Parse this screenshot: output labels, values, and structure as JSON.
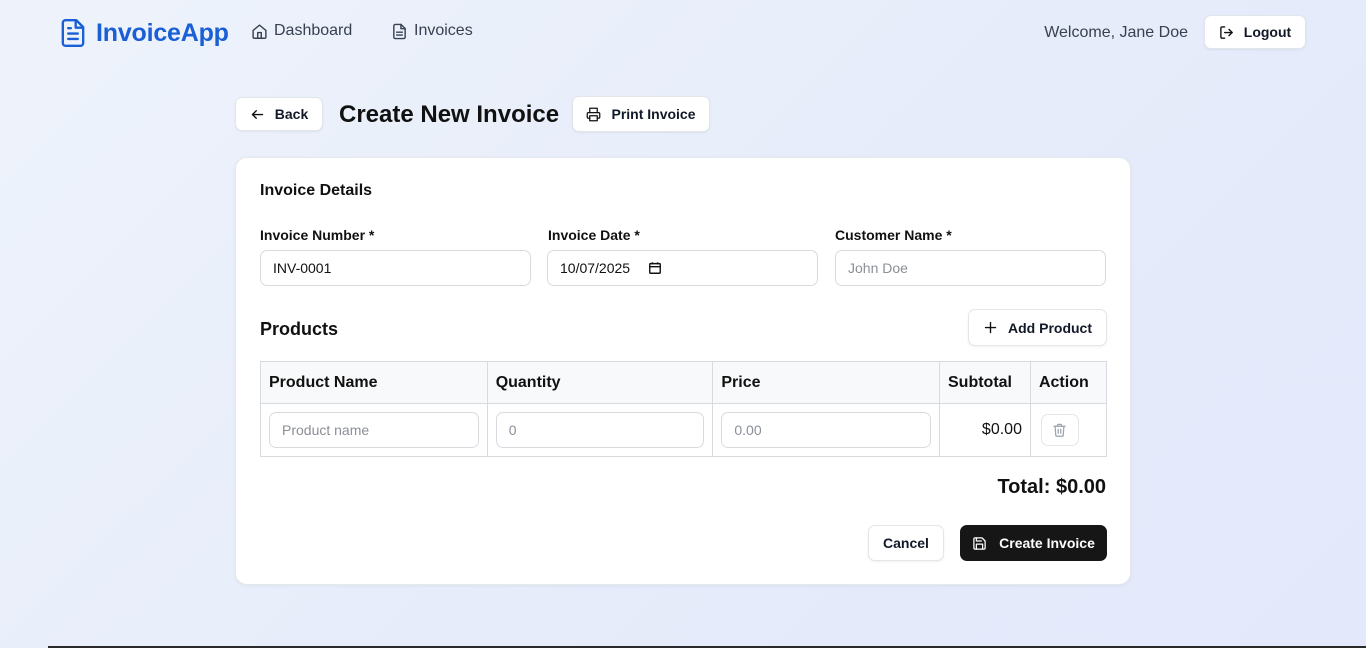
{
  "app": {
    "brand_name": "InvoiceApp",
    "brand_color": "#1a5fd6",
    "brand_icon": "file-text-icon"
  },
  "nav": {
    "items": [
      {
        "label": "Dashboard",
        "icon": "home-icon"
      },
      {
        "label": "Invoices",
        "icon": "file-text-icon"
      }
    ],
    "welcome": "Welcome, Jane Doe",
    "logout_label": "Logout",
    "logout_icon": "log-out-icon"
  },
  "header": {
    "back_label": "Back",
    "title": "Create New Invoice",
    "print_label": "Print Invoice"
  },
  "form": {
    "section_title": "Invoice Details",
    "invoice_number": {
      "label": "Invoice Number *",
      "value": "INV-0001"
    },
    "invoice_date": {
      "label": "Invoice Date *",
      "value": "10/07/2025"
    },
    "customer_name": {
      "label": "Customer Name *",
      "placeholder": "John Doe",
      "value": ""
    }
  },
  "products": {
    "title": "Products",
    "add_label": "Add Product",
    "columns": [
      "Product Name",
      "Quantity",
      "Price",
      "Subtotal",
      "Action"
    ],
    "rows": [
      {
        "name_placeholder": "Product name",
        "quantity_placeholder": "0",
        "price_placeholder": "0.00",
        "subtotal": "$0.00"
      }
    ]
  },
  "summary": {
    "total": "Total: $0.00"
  },
  "actions": {
    "cancel_label": "Cancel",
    "create_label": "Create Invoice",
    "create_color": "#161616"
  }
}
